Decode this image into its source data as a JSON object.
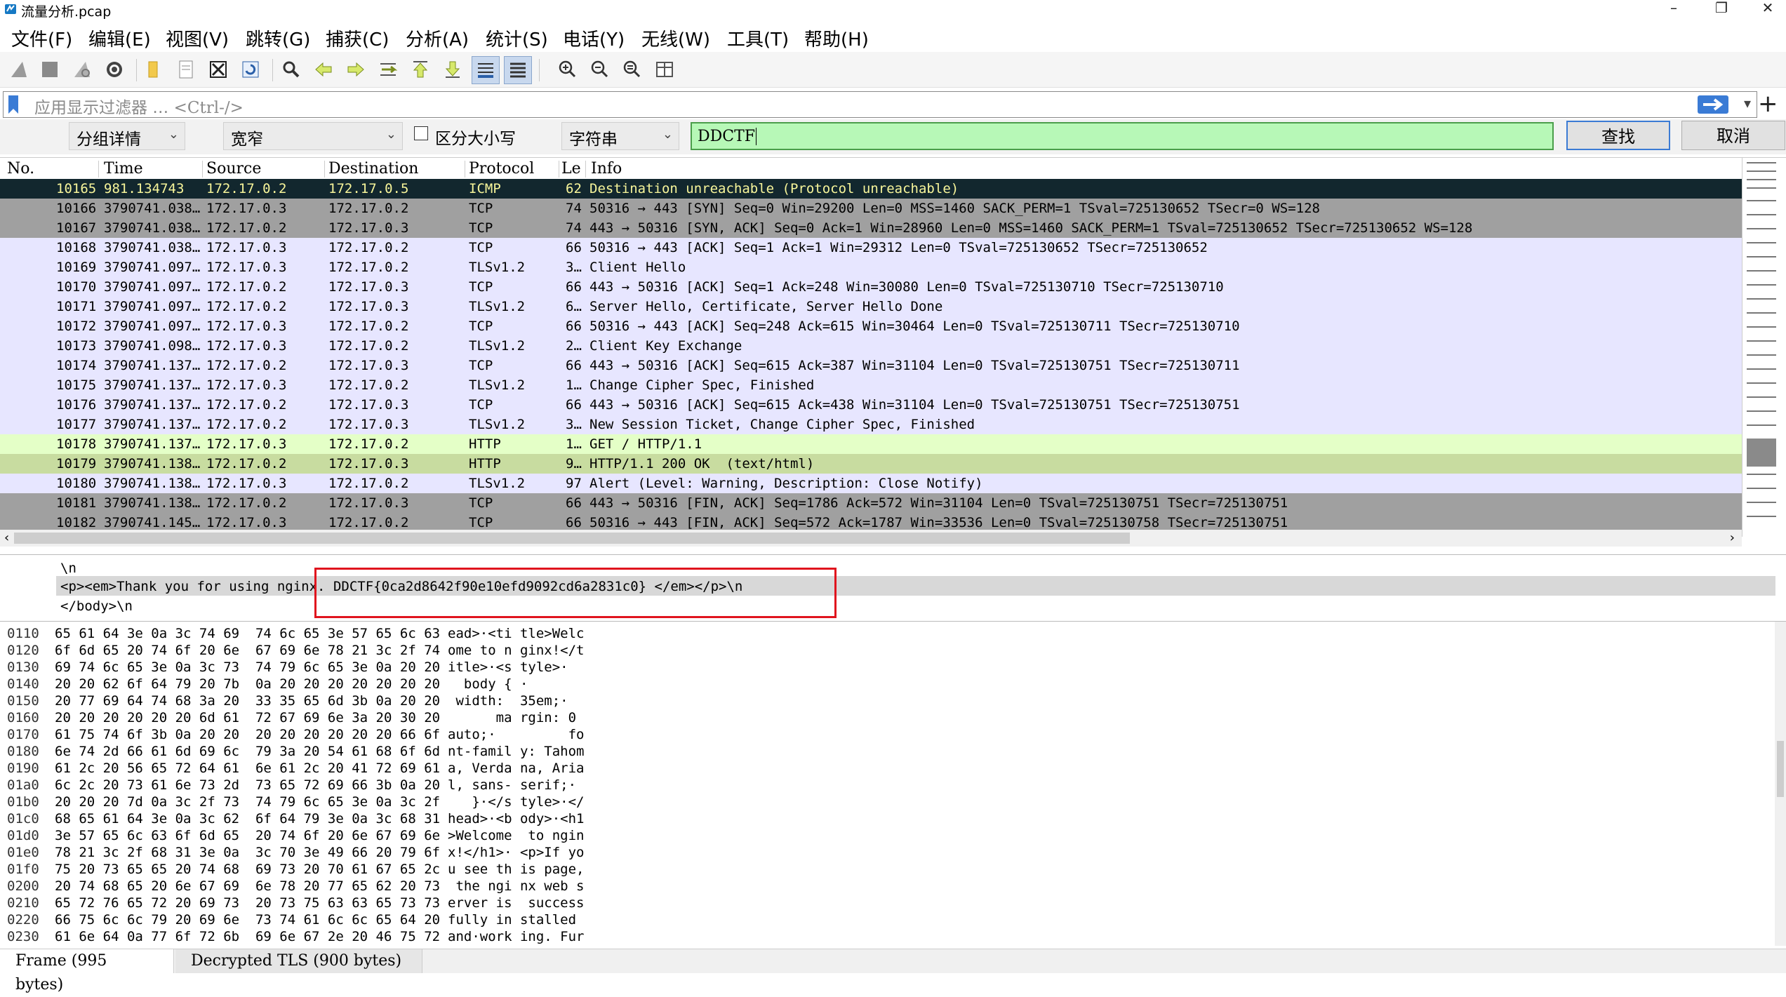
{
  "window": {
    "title": "流量分析.pcap",
    "minimize": "–",
    "maximize": "❐",
    "close": "✕"
  },
  "menu": [
    "文件(F)",
    "编辑(E)",
    "视图(V)",
    "跳转(G)",
    "捕获(C)",
    "分析(A)",
    "统计(S)",
    "电话(Y)",
    "无线(W)",
    "工具(T)",
    "帮助(H)"
  ],
  "toolbar_icons": [
    "shark-fin-start-icon",
    "stop-square-icon",
    "shark-fin-restart-icon",
    "gear-options-icon",
    "folder-open-icon",
    "save-file-icon",
    "close-file-icon",
    "reload-icon",
    "find-magnifier-icon",
    "back-arrow-icon",
    "forward-arrow-icon",
    "go-to-packet-icon",
    "first-packet-icon",
    "last-packet-icon",
    "autoscroll-icon",
    "colorize-icon",
    "zoom-in-icon",
    "zoom-out-icon",
    "zoom-normal-icon",
    "resize-columns-icon"
  ],
  "filter": {
    "placeholder_a": "应用显示过滤器 …",
    "placeholder_b": "<Ctrl-/>",
    "add": "+",
    "dropdown": "▾"
  },
  "find": {
    "search_in": "分组详情",
    "charset": "宽窄",
    "case_label": "区分大小写",
    "type": "字符串",
    "query": "DDCTF",
    "find_btn": "查找",
    "cancel_btn": "取消"
  },
  "packet_list": {
    "columns": [
      "No.",
      "Time",
      "Source",
      "Destination",
      "Protocol",
      "Le",
      "Info"
    ],
    "rows": [
      {
        "no": "10165",
        "time": "981.134743",
        "src": "172.17.0.2",
        "dst": "172.17.0.5",
        "proto": "ICMP",
        "len": "62",
        "info": "Destination unreachable (Protocol unreachable)",
        "style": "selected"
      },
      {
        "no": "10166",
        "time": "3790741.038…",
        "src": "172.17.0.3",
        "dst": "172.17.0.2",
        "proto": "TCP",
        "len": "74",
        "info": "50316 → 443 [SYN] Seq=0 Win=29200 Len=0 MSS=1460 SACK_PERM=1 TSval=725130652 TSecr=0 WS=128",
        "style": "gray"
      },
      {
        "no": "10167",
        "time": "3790741.038…",
        "src": "172.17.0.2",
        "dst": "172.17.0.3",
        "proto": "TCP",
        "len": "74",
        "info": "443 → 50316 [SYN, ACK] Seq=0 Ack=1 Win=28960 Len=0 MSS=1460 SACK_PERM=1 TSval=725130652 TSecr=725130652 WS=128",
        "style": "gray"
      },
      {
        "no": "10168",
        "time": "3790741.038…",
        "src": "172.17.0.3",
        "dst": "172.17.0.2",
        "proto": "TCP",
        "len": "66",
        "info": "50316 → 443 [ACK] Seq=1 Ack=1 Win=29312 Len=0 TSval=725130652 TSecr=725130652",
        "style": "lav"
      },
      {
        "no": "10169",
        "time": "3790741.097…",
        "src": "172.17.0.3",
        "dst": "172.17.0.2",
        "proto": "TLSv1.2",
        "len": "3…",
        "info": "Client Hello",
        "style": "lav"
      },
      {
        "no": "10170",
        "time": "3790741.097…",
        "src": "172.17.0.2",
        "dst": "172.17.0.3",
        "proto": "TCP",
        "len": "66",
        "info": "443 → 50316 [ACK] Seq=1 Ack=248 Win=30080 Len=0 TSval=725130710 TSecr=725130710",
        "style": "lav"
      },
      {
        "no": "10171",
        "time": "3790741.097…",
        "src": "172.17.0.2",
        "dst": "172.17.0.3",
        "proto": "TLSv1.2",
        "len": "6…",
        "info": "Server Hello, Certificate, Server Hello Done",
        "style": "lav"
      },
      {
        "no": "10172",
        "time": "3790741.097…",
        "src": "172.17.0.3",
        "dst": "172.17.0.2",
        "proto": "TCP",
        "len": "66",
        "info": "50316 → 443 [ACK] Seq=248 Ack=615 Win=30464 Len=0 TSval=725130711 TSecr=725130710",
        "style": "lav"
      },
      {
        "no": "10173",
        "time": "3790741.098…",
        "src": "172.17.0.3",
        "dst": "172.17.0.2",
        "proto": "TLSv1.2",
        "len": "2…",
        "info": "Client Key Exchange",
        "style": "lav"
      },
      {
        "no": "10174",
        "time": "3790741.137…",
        "src": "172.17.0.2",
        "dst": "172.17.0.3",
        "proto": "TCP",
        "len": "66",
        "info": "443 → 50316 [ACK] Seq=615 Ack=387 Win=31104 Len=0 TSval=725130751 TSecr=725130711",
        "style": "lav"
      },
      {
        "no": "10175",
        "time": "3790741.137…",
        "src": "172.17.0.3",
        "dst": "172.17.0.2",
        "proto": "TLSv1.2",
        "len": "1…",
        "info": "Change Cipher Spec, Finished",
        "style": "lav"
      },
      {
        "no": "10176",
        "time": "3790741.137…",
        "src": "172.17.0.2",
        "dst": "172.17.0.3",
        "proto": "TCP",
        "len": "66",
        "info": "443 → 50316 [ACK] Seq=615 Ack=438 Win=31104 Len=0 TSval=725130751 TSecr=725130751",
        "style": "lav"
      },
      {
        "no": "10177",
        "time": "3790741.137…",
        "src": "172.17.0.2",
        "dst": "172.17.0.3",
        "proto": "TLSv1.2",
        "len": "3…",
        "info": "New Session Ticket, Change Cipher Spec, Finished",
        "style": "lav"
      },
      {
        "no": "10178",
        "time": "3790741.137…",
        "src": "172.17.0.3",
        "dst": "172.17.0.2",
        "proto": "HTTP",
        "len": "1…",
        "info": "GET / HTTP/1.1",
        "style": "green"
      },
      {
        "no": "10179",
        "time": "3790741.138…",
        "src": "172.17.0.2",
        "dst": "172.17.0.3",
        "proto": "HTTP",
        "len": "9…",
        "info": "HTTP/1.1 200 OK  (text/html)",
        "style": "green2"
      },
      {
        "no": "10180",
        "time": "3790741.138…",
        "src": "172.17.0.3",
        "dst": "172.17.0.2",
        "proto": "TLSv1.2",
        "len": "97",
        "info": "Alert (Level: Warning, Description: Close Notify)",
        "style": "lav"
      },
      {
        "no": "10181",
        "time": "3790741.138…",
        "src": "172.17.0.2",
        "dst": "172.17.0.3",
        "proto": "TCP",
        "len": "66",
        "info": "443 → 50316 [FIN, ACK] Seq=1786 Ack=572 Win=31104 Len=0 TSval=725130751 TSecr=725130751",
        "style": "gray"
      },
      {
        "no": "10182",
        "time": "3790741.145…",
        "src": "172.17.0.3",
        "dst": "172.17.0.2",
        "proto": "TCP",
        "len": "66",
        "info": "50316 → 443 [FIN, ACK] Seq=572 Ack=1787 Win=33536 Len=0 TSval=725130758 TSecr=725130751",
        "style": "gray"
      }
    ]
  },
  "details": {
    "line1": "\\n",
    "line2a": "<p><em>Thank you for using nginx.",
    "line2b": "DDCTF{0ca2d8642f90e10efd9092cd6a2831c0} </em></p>\\n",
    "line3": "</body>\\n"
  },
  "bytes": [
    {
      "off": "0110",
      "hex": "65 61 64 3e 0a 3c 74 69  74 6c 65 3e 57 65 6c 63",
      "asc": "ead>·<ti tle>Welc"
    },
    {
      "off": "0120",
      "hex": "6f 6d 65 20 74 6f 20 6e  67 69 6e 78 21 3c 2f 74",
      "asc": "ome to n ginx!</t"
    },
    {
      "off": "0130",
      "hex": "69 74 6c 65 3e 0a 3c 73  74 79 6c 65 3e 0a 20 20",
      "asc": "itle>·<s tyle>·  "
    },
    {
      "off": "0140",
      "hex": "20 20 62 6f 64 79 20 7b  0a 20 20 20 20 20 20 20",
      "asc": "  body { ·       "
    },
    {
      "off": "0150",
      "hex": "20 77 69 64 74 68 3a 20  33 35 65 6d 3b 0a 20 20",
      "asc": " width:  35em;·  "
    },
    {
      "off": "0160",
      "hex": "20 20 20 20 20 20 6d 61  72 67 69 6e 3a 20 30 20",
      "asc": "      ma rgin: 0 "
    },
    {
      "off": "0170",
      "hex": "61 75 74 6f 3b 0a 20 20  20 20 20 20 20 20 66 6f",
      "asc": "auto;·         fo"
    },
    {
      "off": "0180",
      "hex": "6e 74 2d 66 61 6d 69 6c  79 3a 20 54 61 68 6f 6d",
      "asc": "nt-famil y: Tahom"
    },
    {
      "off": "0190",
      "hex": "61 2c 20 56 65 72 64 61  6e 61 2c 20 41 72 69 61",
      "asc": "a, Verda na, Aria"
    },
    {
      "off": "01a0",
      "hex": "6c 2c 20 73 61 6e 73 2d  73 65 72 69 66 3b 0a 20",
      "asc": "l, sans- serif;· "
    },
    {
      "off": "01b0",
      "hex": "20 20 20 7d 0a 3c 2f 73  74 79 6c 65 3e 0a 3c 2f",
      "asc": "   }·</s tyle>·</"
    },
    {
      "off": "01c0",
      "hex": "68 65 61 64 3e 0a 3c 62  6f 64 79 3e 0a 3c 68 31",
      "asc": "head>·<b ody>·<h1"
    },
    {
      "off": "01d0",
      "hex": "3e 57 65 6c 63 6f 6d 65  20 74 6f 20 6e 67 69 6e",
      "asc": ">Welcome  to ngin"
    },
    {
      "off": "01e0",
      "hex": "78 21 3c 2f 68 31 3e 0a  3c 70 3e 49 66 20 79 6f",
      "asc": "x!</h1>· <p>If yo"
    },
    {
      "off": "01f0",
      "hex": "75 20 73 65 65 20 74 68  69 73 20 70 61 67 65 2c",
      "asc": "u see th is page,"
    },
    {
      "off": "0200",
      "hex": "20 74 68 65 20 6e 67 69  6e 78 20 77 65 62 20 73",
      "asc": " the ngi nx web s"
    },
    {
      "off": "0210",
      "hex": "65 72 76 65 72 20 69 73  20 73 75 63 63 65 73 73",
      "asc": "erver is  success"
    },
    {
      "off": "0220",
      "hex": "66 75 6c 6c 79 20 69 6e  73 74 61 6c 6c 65 64 20",
      "asc": "fully in stalled "
    },
    {
      "off": "0230",
      "hex": "61 6e 64 0a 77 6f 72 6b  69 6e 67 2e 20 46 75 72",
      "asc": "and·work ing. Fur"
    }
  ],
  "tabs": {
    "frame": "Frame (995 bytes)",
    "tls": "Decrypted TLS (900 bytes)"
  },
  "colors": {
    "selected_bg": "#12272e",
    "selected_fg": "#f7f59a",
    "gray_bg": "#a0a0a0",
    "lav_bg": "#e7e6ff",
    "green_bg": "#e4ffc7",
    "green2_bg": "#c8dca0",
    "highlight_box": "#e0141e",
    "find_bg": "#b7f8b7"
  }
}
